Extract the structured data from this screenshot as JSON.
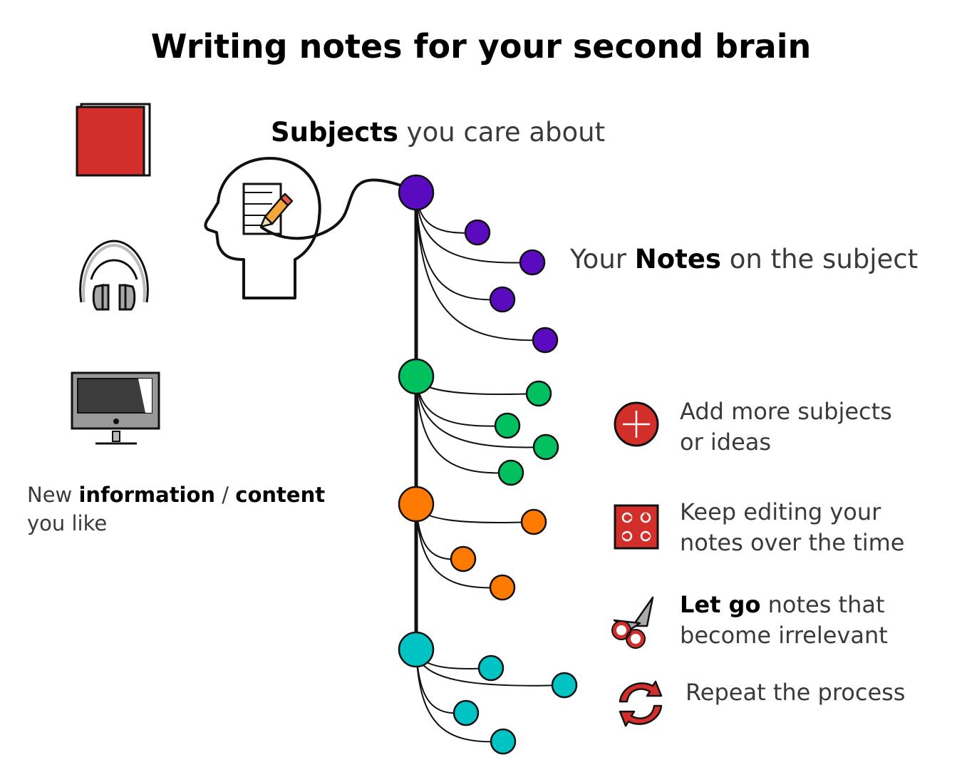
{
  "title": "Writing notes for your second brain",
  "subjects_label": {
    "bold": "Subjects",
    "rest": " you care about"
  },
  "notes_label": {
    "pre": "Your ",
    "bold": "Notes",
    "rest": " on the subject"
  },
  "info_label": {
    "pre": "New ",
    "bold1": "information",
    "sep": " / ",
    "bold2": "content",
    "line2": "you like"
  },
  "sources": [
    {
      "icon": "book-icon"
    },
    {
      "icon": "headphones-icon"
    },
    {
      "icon": "monitor-icon"
    }
  ],
  "actions": [
    {
      "icon": "add-icon",
      "line1": "Add more subjects",
      "line2": "or ideas",
      "color": "#d32f2a"
    },
    {
      "icon": "edit-board-icon",
      "line1": "Keep editing your",
      "line2": "notes over the time",
      "color": "#d32f2a"
    },
    {
      "icon": "scissors-icon",
      "bold": "Let go",
      "line1_rest": " notes that",
      "line2": "become irrelevant",
      "color": "#d32f2a"
    },
    {
      "icon": "repeat-icon",
      "line1": "Repeat the process",
      "color": "#d32f2a"
    }
  ],
  "subject_colors": [
    "#5b0bbf",
    "#00c060",
    "#ff7a00",
    "#00c4c4"
  ]
}
